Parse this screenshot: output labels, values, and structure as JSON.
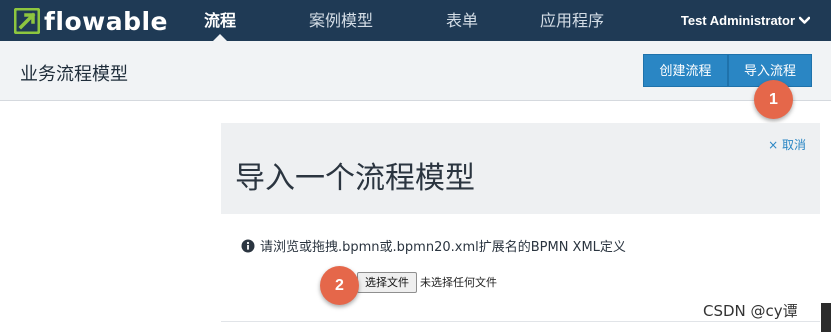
{
  "brand": {
    "name": "flowable",
    "accent": "#1f3a55",
    "logo_color": "#8dc63f"
  },
  "nav": {
    "items": [
      {
        "label": "流程",
        "active": true
      },
      {
        "label": "案例模型",
        "active": false
      },
      {
        "label": "表单",
        "active": false
      },
      {
        "label": "应用程序",
        "active": false
      }
    ],
    "user": "Test Administrator",
    "user_icon": "chevron-down-icon"
  },
  "subheader": {
    "title": "业务流程模型",
    "create_label": "创建流程",
    "import_label": "导入流程",
    "button_color": "#2a86c4"
  },
  "callouts": {
    "one": "1",
    "two": "2",
    "color": "#e5674a"
  },
  "import_panel": {
    "cancel_label": "× 取消",
    "title": "导入一个流程模型",
    "info_icon": "info-circle-icon",
    "info_text": "请浏览或拖拽.bpmn或.bpmn20.xml扩展名的BPMN XML定义",
    "file_button_label": "选择文件",
    "file_status": "未选择任何文件"
  },
  "watermark": "CSDN @cy谭"
}
